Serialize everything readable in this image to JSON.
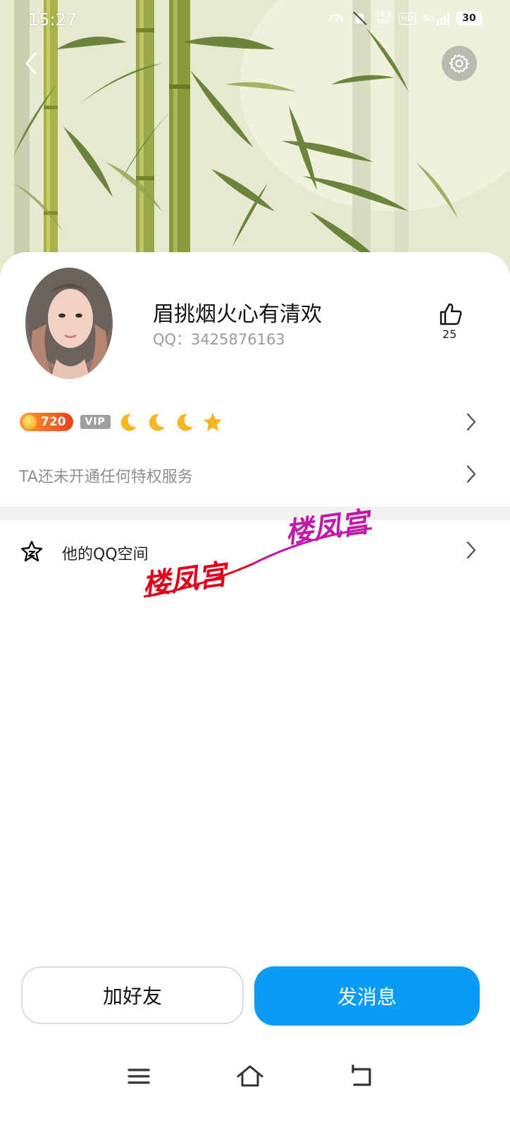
{
  "status_bar": {
    "time": "15:27",
    "net_speed_value": "16.9",
    "net_speed_unit": "KB/s",
    "hd_label": "HD",
    "network_label": "5G",
    "battery": "30"
  },
  "profile": {
    "nickname": "眉挑烟火心有清欢",
    "qq_label": "QQ：3425876163",
    "like_count": "25",
    "level_number": "720",
    "vip_label": "VIP",
    "level_icons": [
      "moon-icon",
      "moon-icon",
      "moon-icon",
      "star-icon"
    ]
  },
  "privilege": {
    "text": "TA还未开通任何特权服务"
  },
  "qzone": {
    "label": "他的QQ空间"
  },
  "watermark": {
    "text_1": "楼凤宫",
    "text_2": "楼凤宫",
    "color_1": "#e0001b",
    "color_2": "#c01aa8"
  },
  "actions": {
    "add_friend": "加好友",
    "send_message": "发消息"
  },
  "colors": {
    "accent": "#0a9bf7",
    "level_badge": "#e8411c"
  }
}
